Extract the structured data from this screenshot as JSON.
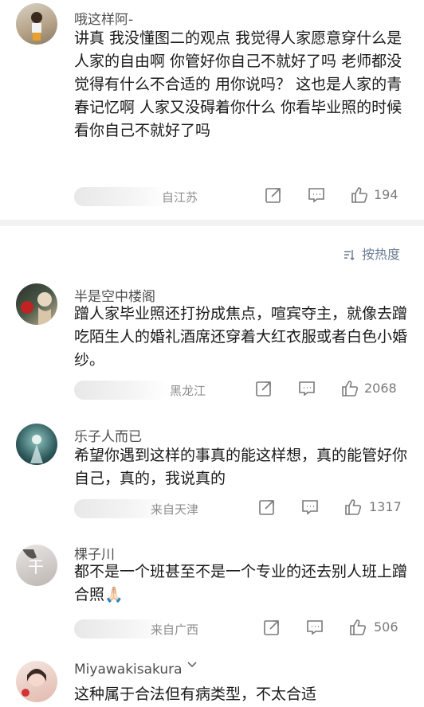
{
  "comments": [
    {
      "username": "哦这样阿-",
      "text": "讲真 我没懂图二的观点 我觉得人家愿意穿什么是人家的自由啊 你管好你自己不就好了吗 老师都没觉得有什么不合适的 用你说吗？ 这也是人家的青春记忆啊 人家又没碍着你什么 你看毕业照的时候看你自己不就好了吗",
      "location": "自江苏",
      "likes": "194"
    },
    {
      "username": "半是空中楼阁",
      "text": "蹭人家毕业照还打扮成焦点，喧宾夺主，就像去蹭吃陌生人的婚礼酒席还穿着大红衣服或者白色小婚纱。",
      "location": "黑龙江",
      "likes": "2068"
    },
    {
      "username": "乐子人而已",
      "text": "希望你遇到这样的事真的能这样想，真的能管好你自己，真的，我说真的",
      "location": "来自天津",
      "likes": "1317"
    },
    {
      "username": "棵子川",
      "avatar_text": "干",
      "text": "都不是一个班甚至不是一个专业的还去别人班上蹭合照🙏🏻",
      "location": "来自广西",
      "likes": "506"
    },
    {
      "username": "Miyawakisakura",
      "text": "这种属于合法但有病类型，不太合适"
    }
  ],
  "sort": {
    "label": "按热度"
  },
  "colors": {
    "accent": "#6b7c93",
    "divider": "#f2f2f2"
  },
  "icons": [
    "share-icon",
    "comment-icon",
    "like-icon",
    "sort-icon",
    "chevron-down-icon"
  ]
}
